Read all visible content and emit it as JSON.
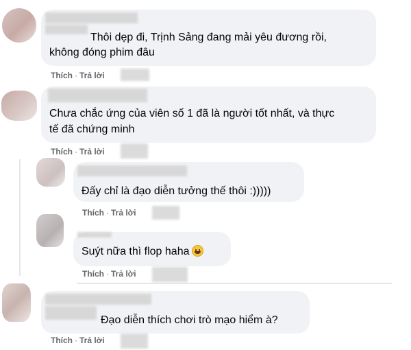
{
  "comments": [
    {
      "text_lines": [
        "Thôi dẹp đi, Trịnh Sảng đang mải yêu đương rồi,",
        "không đóng phim đâu"
      ],
      "like_label": "Thích",
      "reply_label": "Trả lời"
    },
    {
      "text_lines": [
        "Chưa chắc ứng của viên số 1 đã là người tốt nhất, và thực",
        "tế đã chứng minh"
      ],
      "like_label": "Thích",
      "reply_label": "Trả lời"
    },
    {
      "text_lines": [
        "Đấy chỉ là đạo diễn tưởng thế thôi :)))))"
      ],
      "like_label": "Thích",
      "reply_label": "Trả lời"
    },
    {
      "text_lines": [
        "Suýt nữa thì flop haha"
      ],
      "emoji": "grinning-face",
      "like_label": "Thích",
      "reply_label": "Trả lời"
    },
    {
      "text_lines": [
        "Đạo diễn thích chơi trò mạo hiểm à?"
      ],
      "like_label": "Thích",
      "reply_label": "Trả lời"
    }
  ],
  "separator": "·",
  "colors": {
    "bubble_bg": "#f0f2f5",
    "text": "#050505",
    "action_text": "#65676b"
  }
}
